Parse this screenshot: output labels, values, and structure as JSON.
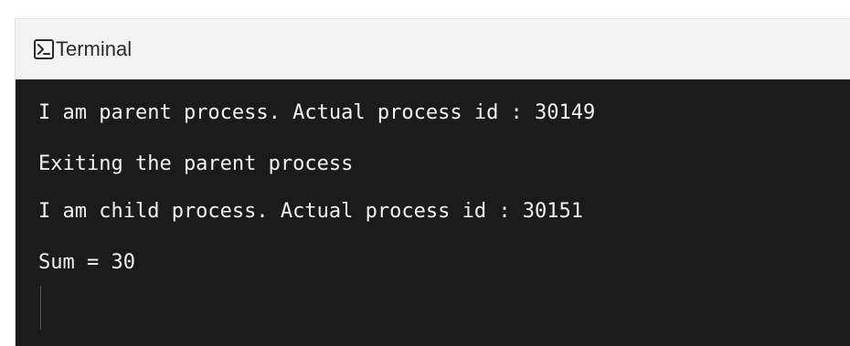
{
  "terminal": {
    "title": "Terminal",
    "icon": "terminal-icon",
    "output_lines": [
      "I am parent process. Actual process id : 30149",
      "Exiting the parent process",
      "I am child process. Actual process id : 30151",
      "Sum = 30"
    ]
  }
}
